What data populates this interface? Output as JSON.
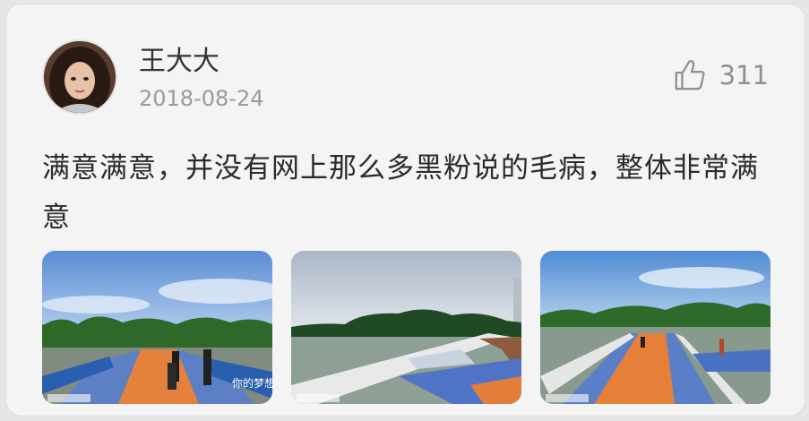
{
  "review": {
    "username": "王大大",
    "date": "2018-08-24",
    "likes": "311",
    "text": "满意满意，并没有网上那么多黑粉说的毛病，整体非常满意"
  },
  "icons": {
    "like": "thumbs-up-icon"
  },
  "photos": [
    {
      "banner_text": "你的梦想"
    },
    {
      "banner_text": ""
    },
    {
      "banner_text": ""
    }
  ],
  "colors": {
    "card_bg": "#f4f4f4",
    "text_primary": "#2b2b2b",
    "text_secondary": "#9a9a9a",
    "like_icon": "#8f8f8f"
  }
}
